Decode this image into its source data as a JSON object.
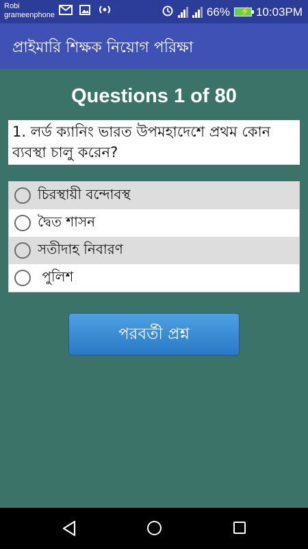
{
  "status_bar": {
    "carrier_line1": "Robi",
    "carrier_line2": "grameenphone",
    "battery_percent": "66%",
    "time": "10:03PM",
    "icons": [
      "mail-icon",
      "image-icon",
      "hotspot-icon",
      "alarm-icon",
      "signal-icon",
      "signal-icon",
      "battery-icon"
    ]
  },
  "app_bar": {
    "title": "প্রাইমারি শিক্ষক নিয়োগ পরিক্ষা"
  },
  "quiz": {
    "header": "Questions 1 of 80",
    "question": "1. লর্ড ক্যানিং ভারত উপমহাদেশে প্রথম কোন ব্যবস্থা চালু করেন?",
    "options": [
      {
        "label": "চিরস্থায়ী বন্দোবস্থ"
      },
      {
        "label": "দ্বৈত শাসন"
      },
      {
        "label": "সতীদাহ নিবারণ"
      },
      {
        "label": " পুলিশ"
      }
    ],
    "next_button": "পরবর্তী প্রশ্ন"
  },
  "colors": {
    "status_bar": "#2b3d99",
    "app_bar": "#3f51b5",
    "background": "#3b7369",
    "button": "#2a79c6"
  }
}
